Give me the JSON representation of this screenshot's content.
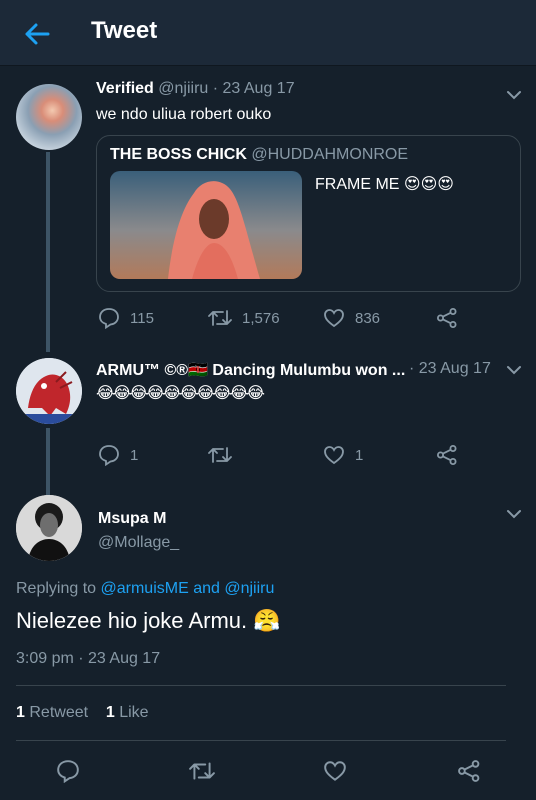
{
  "header": {
    "title": "Tweet"
  },
  "tweet1": {
    "name": "Verified",
    "handle": "@njiiru",
    "date": "· 23 Aug 17",
    "text": "we ndo uliua robert ouko",
    "quote": {
      "name": "THE BOSS CHICK",
      "handle": "@HUDDAHMONROE",
      "text": "FRAME ME 😍😍😍"
    },
    "replies": "115",
    "retweets": "1,576",
    "likes": "836"
  },
  "tweet2": {
    "name": "ARMU™ ©®🇰🇪 Dancing Mulumbu won ...",
    "date": "· 23 Aug 17",
    "text": "😂😂😂😂😂😂😂😂😂😂",
    "replies": "1",
    "retweets": "",
    "likes": "1"
  },
  "main": {
    "name": "Msupa M",
    "handle": "@Mollage_",
    "replying_prefix": "Replying to",
    "reply_user1": "@armuisME",
    "reply_and": "and",
    "reply_user2": "@njiiru",
    "text": "Nielezee hio joke Armu. 😤",
    "timestamp": "3:09 pm · 23 Aug 17",
    "retweet_count": "1",
    "retweet_label": "Retweet",
    "like_count": "1",
    "like_label": "Like"
  },
  "colors": {
    "background": "#15202b",
    "header": "#1c2938",
    "accent": "#1da1f2",
    "muted": "#8899a6"
  }
}
